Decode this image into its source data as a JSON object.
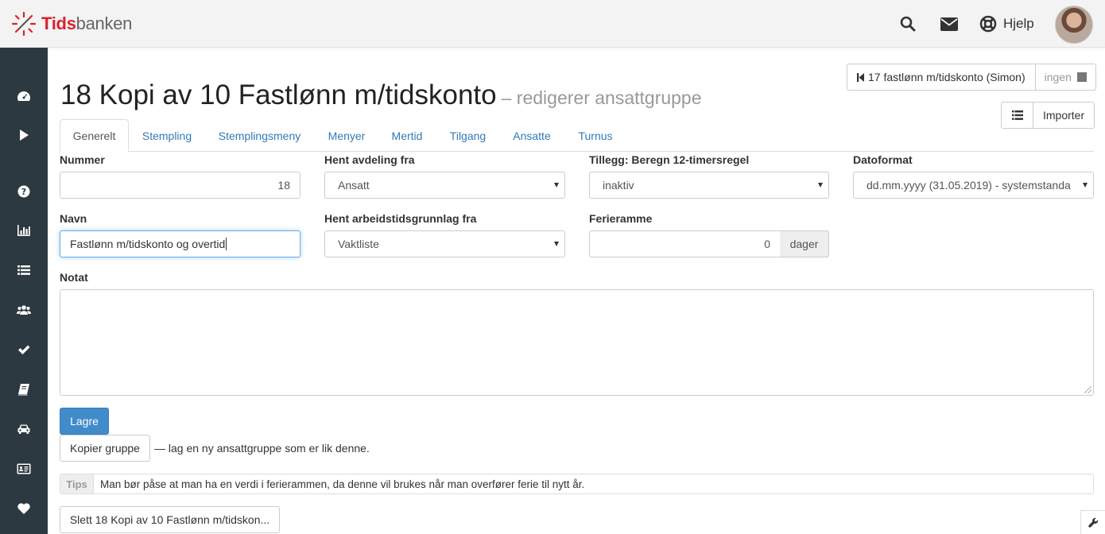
{
  "brand": {
    "part1": "Tids",
    "part2": "banken"
  },
  "topbar": {
    "help_label": "Hjelp"
  },
  "sidebar": {
    "items": [
      {
        "icon": "dashboard-icon"
      },
      {
        "icon": "play-icon"
      },
      {
        "icon": "question-icon"
      },
      {
        "icon": "bar-chart-icon"
      },
      {
        "icon": "list-icon"
      },
      {
        "icon": "users-icon"
      },
      {
        "icon": "check-icon"
      },
      {
        "icon": "book-icon"
      },
      {
        "icon": "car-icon"
      },
      {
        "icon": "id-card-icon"
      },
      {
        "icon": "heart-icon"
      }
    ]
  },
  "page": {
    "title": "18 Kopi av 10 Fastlønn m/tidskonto",
    "subtitle": "– redigerer ansattgruppe",
    "prev_group": "17 fastlønn m/tidskonto (Simon)",
    "next_group": "ingen",
    "import_label": "Importer"
  },
  "tabs": [
    "Generelt",
    "Stempling",
    "Stemplingsmeny",
    "Menyer",
    "Mertid",
    "Tilgang",
    "Ansatte",
    "Turnus"
  ],
  "form": {
    "nummer_label": "Nummer",
    "nummer_value": "18",
    "avdeling_label": "Hent avdeling fra",
    "avdeling_value": "Ansatt",
    "tillegg_label": "Tillegg: Beregn 12-timersregel",
    "tillegg_value": "inaktiv",
    "datoformat_label": "Datoformat",
    "datoformat_value": "dd.mm.yyyy (31.05.2019) - systemstanda",
    "navn_label": "Navn",
    "navn_value": "Fastlønn m/tidskonto og overtid",
    "arbeidstid_label": "Hent arbeidstidsgrunnlag fra",
    "arbeidstid_value": "Vaktliste",
    "ferieramme_label": "Ferieramme",
    "ferieramme_value": "0",
    "ferieramme_unit": "dager",
    "notat_label": "Notat",
    "notat_value": ""
  },
  "actions": {
    "save_label": "Lagre",
    "copy_label": "Kopier gruppe",
    "copy_desc": "— lag en ny ansattgruppe som er lik denne.",
    "delete_label": "Slett 18 Kopi av 10 Fastlønn m/tidskon..."
  },
  "tips": {
    "label": "Tips",
    "text": "Man bør påse at man ha en verdi i ferierammen, da denne vil brukes når man overfører ferie til nytt år."
  },
  "colors": {
    "brand_red": "#d9232e",
    "sidebar_bg": "#2d3941",
    "link_blue": "#337ab7",
    "primary": "#428bca"
  }
}
